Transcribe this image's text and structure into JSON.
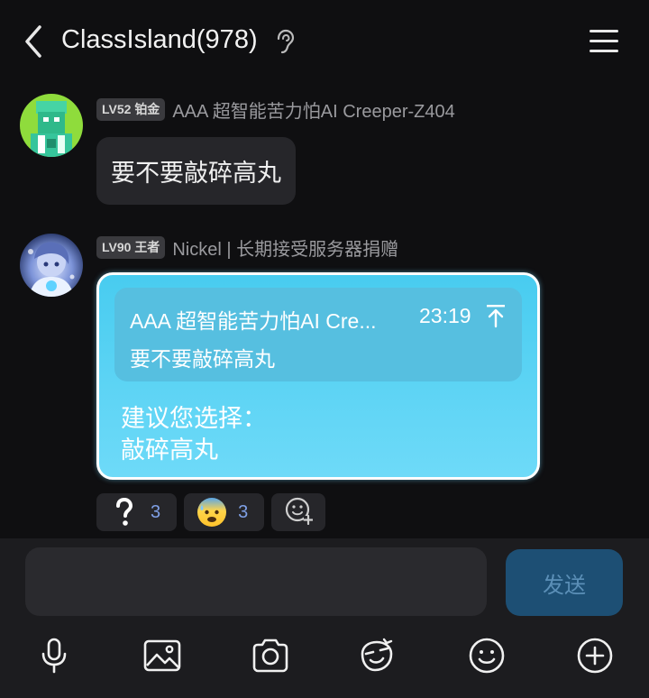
{
  "header": {
    "title": "ClassIsland(978)",
    "back_icon": "chevron-left-icon",
    "ear_icon": "ear-icon",
    "menu_icon": "hamburger-menu-icon"
  },
  "messages": [
    {
      "level": "LV52 铂金",
      "sender": "AAA 超智能苦力怕AI Creeper-Z404",
      "text": "要不要敲碎高丸"
    },
    {
      "level": "LV90 王者",
      "sender": "Nickel | 长期接受服务器捐赠",
      "quote": {
        "author": "AAA 超智能苦力怕AI Cre...",
        "time": "23:19",
        "text": "要不要敲碎高丸"
      },
      "reply_line1": "建议您选择：",
      "reply_line2": "敲碎高丸"
    }
  ],
  "reactions": [
    {
      "emoji": "question-mark-icon",
      "count": "3"
    },
    {
      "emoji": "anxious-sweat-face-icon",
      "count": "3"
    }
  ],
  "input": {
    "placeholder": "",
    "send_label": "发送"
  },
  "toolbar": [
    "microphone-icon",
    "image-icon",
    "camera-icon",
    "sticker-icon",
    "emoji-icon",
    "plus-icon"
  ],
  "colors": {
    "background": "#0f0f11",
    "bubble_dark": "#26262a",
    "bubble_blue": "#5ad2f4",
    "send_button": "#1d4f74",
    "reaction_count": "#7fa0e6"
  }
}
